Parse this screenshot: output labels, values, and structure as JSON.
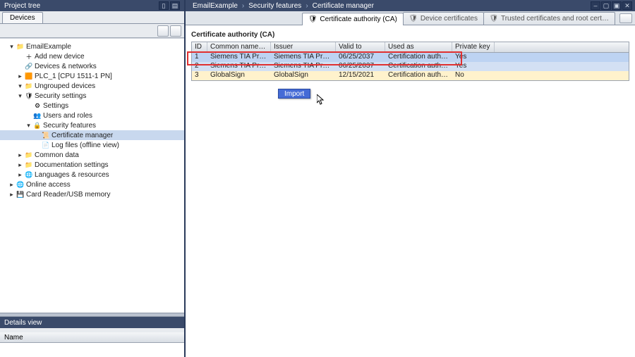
{
  "left_panel": {
    "title": "Project tree",
    "tab": "Devices",
    "tree": [
      {
        "indent": 0,
        "tw": "▾",
        "icon": "project",
        "label": "EmailExample"
      },
      {
        "indent": 1,
        "tw": "",
        "icon": "add",
        "label": "Add new device"
      },
      {
        "indent": 1,
        "tw": "",
        "icon": "net",
        "label": "Devices & networks"
      },
      {
        "indent": 1,
        "tw": "▸",
        "icon": "plc",
        "label": "PLC_1 [CPU 1511-1 PN]"
      },
      {
        "indent": 1,
        "tw": "▾",
        "icon": "folder",
        "label": "Ungrouped devices"
      },
      {
        "indent": 1,
        "tw": "▾",
        "icon": "shield",
        "label": "Security settings"
      },
      {
        "indent": 2,
        "tw": "",
        "icon": "gear",
        "label": "Settings"
      },
      {
        "indent": 2,
        "tw": "",
        "icon": "users",
        "label": "Users and roles"
      },
      {
        "indent": 2,
        "tw": "▾",
        "icon": "lock",
        "label": "Security features"
      },
      {
        "indent": 3,
        "tw": "",
        "icon": "cert",
        "label": "Certificate manager",
        "selected": true
      },
      {
        "indent": 3,
        "tw": "",
        "icon": "log",
        "label": "Log files (offline view)"
      },
      {
        "indent": 1,
        "tw": "▸",
        "icon": "folder",
        "label": "Common data"
      },
      {
        "indent": 1,
        "tw": "▸",
        "icon": "folder",
        "label": "Documentation settings"
      },
      {
        "indent": 1,
        "tw": "▸",
        "icon": "lang",
        "label": "Languages & resources"
      },
      {
        "indent": 0,
        "tw": "▸",
        "icon": "online",
        "label": "Online access"
      },
      {
        "indent": 0,
        "tw": "▸",
        "icon": "usb",
        "label": "Card Reader/USB memory"
      }
    ],
    "details_title": "Details view",
    "details_col": "Name"
  },
  "right_panel": {
    "breadcrumbs": [
      "EmailExample",
      "Security features",
      "Certificate manager"
    ],
    "tabs": [
      {
        "label": "Certificate authority (CA)",
        "active": true
      },
      {
        "label": "Device certificates",
        "active": false
      },
      {
        "label": "Trusted certificates and root cert…",
        "active": false
      }
    ],
    "section_title": "Certificate authority (CA)",
    "columns": [
      "ID",
      "Common name of su…",
      "Issuer",
      "Valid to",
      "Used as",
      "Private key"
    ],
    "rows": [
      {
        "id": "1",
        "cn": "Siemens TIA Project(…",
        "issuer": "Siemens TIA Project(…",
        "valid": "06/25/2037",
        "used": "Certification authorit…",
        "pk": "Yes",
        "style": "sel"
      },
      {
        "id": "2",
        "cn": "Siemens TIA Project(…",
        "issuer": "Siemens TIA Project(…",
        "valid": "06/25/2037",
        "used": "Certification authorit…",
        "pk": "Yes",
        "style": "sel2"
      },
      {
        "id": "3",
        "cn": "GlobalSign",
        "issuer": "GlobalSign",
        "valid": "12/15/2021",
        "used": "Certification authority",
        "pk": "No",
        "style": "hl"
      }
    ],
    "context_menu_item": "Import"
  },
  "icons": {
    "project": "📁",
    "add": "＋",
    "net": "🔗",
    "plc": "🟧",
    "folder": "📁",
    "shield": "🛡",
    "gear": "⚙",
    "users": "👥",
    "lock": "🔒",
    "cert": "📜",
    "log": "📄",
    "lang": "🌐",
    "online": "🌐",
    "usb": "💾",
    "tab_cert": "🛡"
  }
}
